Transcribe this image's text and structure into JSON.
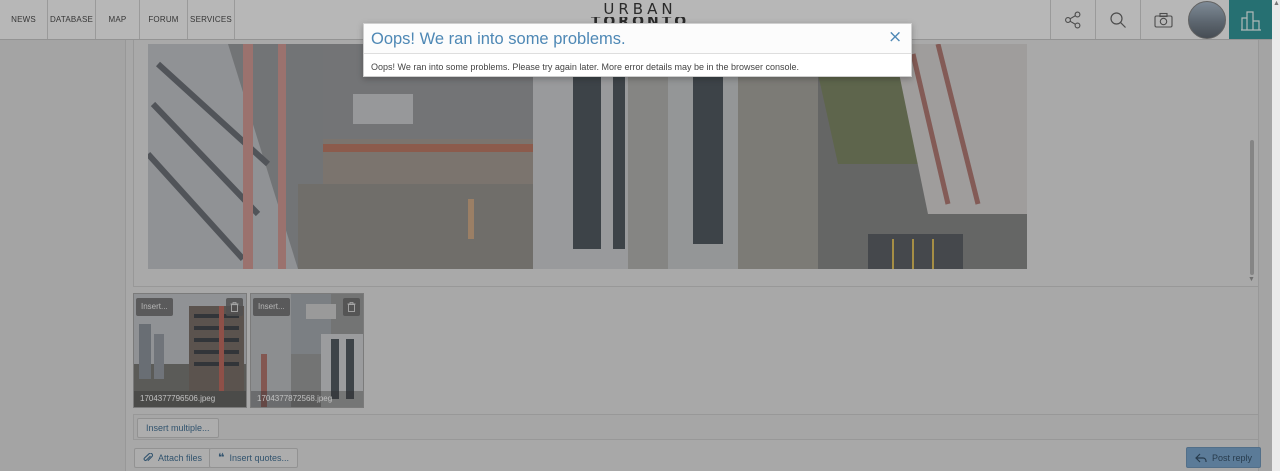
{
  "nav": {
    "items": [
      {
        "label": "NEWS"
      },
      {
        "label": "DATABASE"
      },
      {
        "label": "MAP"
      },
      {
        "label": "FORUM"
      },
      {
        "label": "SERVICES"
      }
    ]
  },
  "logo": {
    "line1": "URBAN",
    "line2": "TORONTO"
  },
  "toolbar": {
    "icons": [
      "share-icon",
      "search-icon",
      "camera-icon",
      "avatar",
      "city-icon"
    ]
  },
  "colors": {
    "accent": "#1d8a8c",
    "link": "#4e88b5",
    "overlay": "rgba(60,60,60,0.32)"
  },
  "modal": {
    "title": "Oops! We ran into some problems.",
    "close": "×",
    "message": "Oops! We ran into some problems. Please try again later. More error details may be in the browser console."
  },
  "attachments": [
    {
      "insert_label": "Insert...",
      "filename": "1704377796506.jpeg"
    },
    {
      "insert_label": "Insert...",
      "filename": "1704377872568.jpeg"
    }
  ],
  "buttons": {
    "insert_multiple": "Insert multiple...",
    "attach_files": "Attach files",
    "insert_quotes": "Insert quotes...",
    "post_reply": "Post reply"
  }
}
